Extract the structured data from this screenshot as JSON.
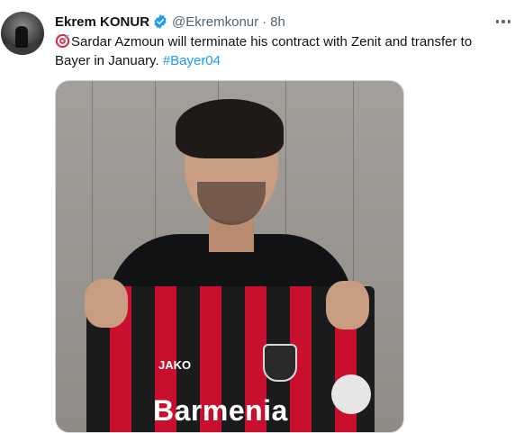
{
  "tweet": {
    "author_name": "Ekrem KONUR",
    "handle": "@Ekremkonur",
    "separator": "·",
    "time": "8h",
    "text_main": "Sardar Azmoun will terminate his contract with Zenit and transfer to Bayer in January. ",
    "hashtag": "#Bayer04"
  },
  "media": {
    "jersey_sponsor": "Barmenia",
    "jersey_brand": "JAKO"
  },
  "colors": {
    "link": "#1d9bf0",
    "verified": "#1d9bf0",
    "secondary_text": "#536471",
    "primary_text": "#0f1419"
  },
  "icons": {
    "verified": "verified-badge-icon",
    "more": "more-dots-icon",
    "emoji": "direct-hit-target-emoji"
  }
}
